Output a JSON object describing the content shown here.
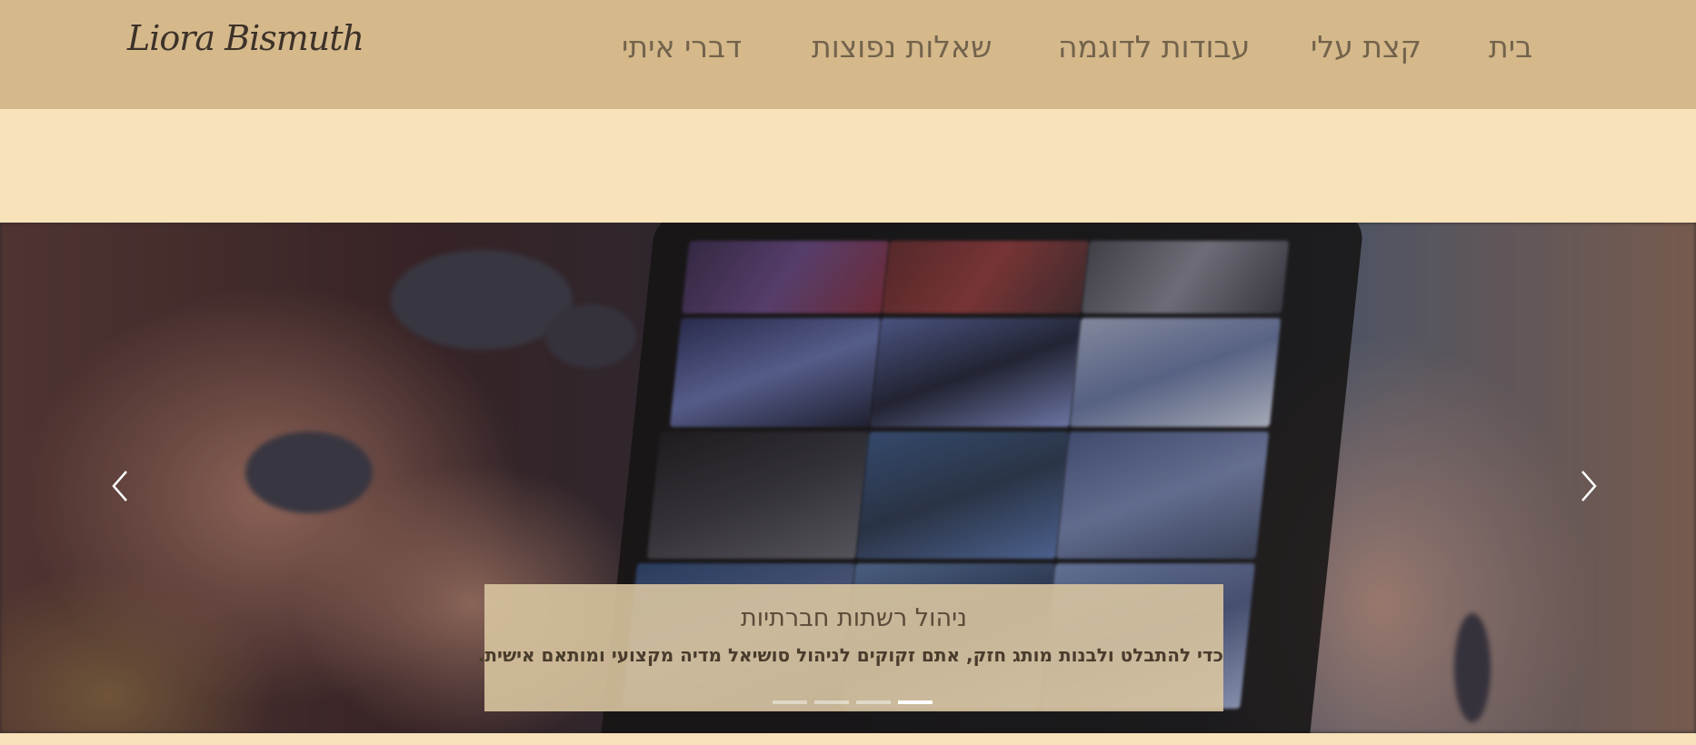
{
  "header": {
    "logo_text": "Liora Bismuth",
    "nav": [
      {
        "id": "home",
        "label": "בית"
      },
      {
        "id": "about",
        "label": "קצת עלי"
      },
      {
        "id": "portfolio",
        "label": "עבודות לדוגמה"
      },
      {
        "id": "faq",
        "label": "שאלות נפוצות"
      },
      {
        "id": "contact",
        "label": "דברי איתי"
      }
    ]
  },
  "slider": {
    "caption_title": "ניהול רשתות חברתיות",
    "caption_text": "כדי להתבלט ולבנות מותג חזק, אתם זקוקים לניהול סושיאל מדיה מקצועי ומותאם אישית.",
    "slide_count": 4,
    "active_slide": 4
  },
  "colors": {
    "header_bg": "#d5b98b",
    "page_bg": "#f7e2b9",
    "nav_text": "#73634c",
    "caption_bg": "#d8c4a0"
  }
}
